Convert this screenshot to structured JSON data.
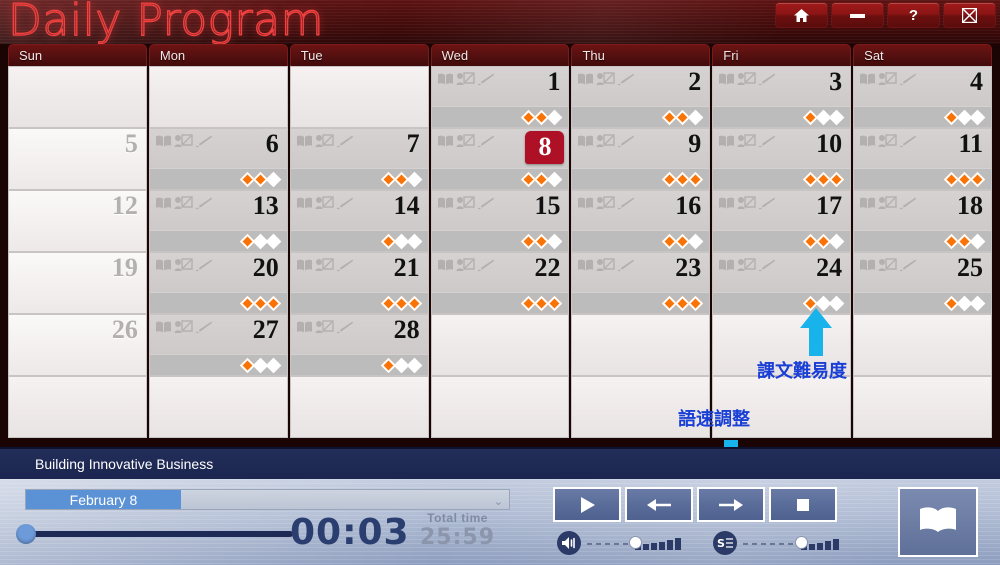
{
  "window": {
    "app_title": "Daily Program",
    "buttons": [
      {
        "name": "home-button",
        "icon": "home-icon",
        "label": ""
      },
      {
        "name": "minimize-button",
        "icon": "minimize-icon",
        "label": ""
      },
      {
        "name": "help-button",
        "icon": "help-icon",
        "label": "?"
      },
      {
        "name": "close-button",
        "icon": "close-icon",
        "label": ""
      }
    ]
  },
  "calendar": {
    "day_headers": [
      "Sun",
      "Mon",
      "Tue",
      "Wed",
      "Thu",
      "Fri",
      "Sat"
    ],
    "selected_day": 8,
    "cell_icons": [
      "book-icon",
      "presentation-icon",
      "pencil-icon"
    ],
    "weeks": [
      [
        {
          "day": "",
          "state": "empty",
          "difficulty": null
        },
        {
          "day": "",
          "state": "empty",
          "difficulty": null
        },
        {
          "day": "",
          "state": "empty",
          "difficulty": null
        },
        {
          "day": "1",
          "state": "active",
          "difficulty": 2
        },
        {
          "day": "2",
          "state": "active",
          "difficulty": 2
        },
        {
          "day": "3",
          "state": "active",
          "difficulty": 1
        },
        {
          "day": "4",
          "state": "active",
          "difficulty": 1
        }
      ],
      [
        {
          "day": "5",
          "state": "inactive",
          "difficulty": null
        },
        {
          "day": "6",
          "state": "active",
          "difficulty": 2
        },
        {
          "day": "7",
          "state": "active",
          "difficulty": 2
        },
        {
          "day": "8",
          "state": "active",
          "difficulty": 2,
          "selected": true
        },
        {
          "day": "9",
          "state": "active",
          "difficulty": 3
        },
        {
          "day": "10",
          "state": "active",
          "difficulty": 3
        },
        {
          "day": "11",
          "state": "active",
          "difficulty": 3
        }
      ],
      [
        {
          "day": "12",
          "state": "inactive",
          "difficulty": null
        },
        {
          "day": "13",
          "state": "active",
          "difficulty": 1
        },
        {
          "day": "14",
          "state": "active",
          "difficulty": 1
        },
        {
          "day": "15",
          "state": "active",
          "difficulty": 2
        },
        {
          "day": "16",
          "state": "active",
          "difficulty": 2
        },
        {
          "day": "17",
          "state": "active",
          "difficulty": 2
        },
        {
          "day": "18",
          "state": "active",
          "difficulty": 2
        }
      ],
      [
        {
          "day": "19",
          "state": "inactive",
          "difficulty": null
        },
        {
          "day": "20",
          "state": "active",
          "difficulty": 3
        },
        {
          "day": "21",
          "state": "active",
          "difficulty": 3
        },
        {
          "day": "22",
          "state": "active",
          "difficulty": 3
        },
        {
          "day": "23",
          "state": "active",
          "difficulty": 3
        },
        {
          "day": "24",
          "state": "active",
          "difficulty": 1
        },
        {
          "day": "25",
          "state": "active",
          "difficulty": 1
        }
      ],
      [
        {
          "day": "26",
          "state": "inactive",
          "difficulty": null
        },
        {
          "day": "27",
          "state": "active",
          "difficulty": 1
        },
        {
          "day": "28",
          "state": "active",
          "difficulty": 1
        },
        {
          "day": "",
          "state": "empty",
          "difficulty": null
        },
        {
          "day": "",
          "state": "empty",
          "difficulty": null
        },
        {
          "day": "",
          "state": "empty",
          "difficulty": null
        },
        {
          "day": "",
          "state": "empty",
          "difficulty": null
        }
      ],
      [
        {
          "day": "",
          "state": "empty",
          "difficulty": null
        },
        {
          "day": "",
          "state": "empty",
          "difficulty": null
        },
        {
          "day": "",
          "state": "empty",
          "difficulty": null
        },
        {
          "day": "",
          "state": "empty",
          "difficulty": null
        },
        {
          "day": "",
          "state": "empty",
          "difficulty": null
        },
        {
          "day": "",
          "state": "empty",
          "difficulty": null
        },
        {
          "day": "",
          "state": "empty",
          "difficulty": null
        }
      ]
    ]
  },
  "annotations": {
    "difficulty": "課文難易度",
    "speed": "語速調整",
    "arrow_color": "#19b3ec",
    "text_color": "#1a3fd6"
  },
  "player": {
    "title": "Building Innovative Business",
    "date_select": {
      "value": "February 8",
      "caret": "chevron-down-icon"
    },
    "current_time": "00:03",
    "total_time_label": "Total time",
    "total_time": "25:59",
    "controls": [
      {
        "name": "play-button",
        "icon": "play-icon"
      },
      {
        "name": "previous-button",
        "icon": "arrow-left-icon"
      },
      {
        "name": "next-button",
        "icon": "arrow-right-icon"
      },
      {
        "name": "stop-button",
        "icon": "stop-icon"
      }
    ],
    "book_button": {
      "name": "book-button",
      "icon": "open-book-icon"
    },
    "volume_slider": {
      "icon": "speaker-icon",
      "value": 45
    },
    "speed_slider": {
      "icon": "speed-icon",
      "value": 55
    }
  },
  "colors": {
    "accent_red": "#ae1026",
    "title_red": "#f04040",
    "diamond_orange": "#f97306",
    "player_blue": "#1b2550",
    "select_blue": "#5b92d6"
  }
}
